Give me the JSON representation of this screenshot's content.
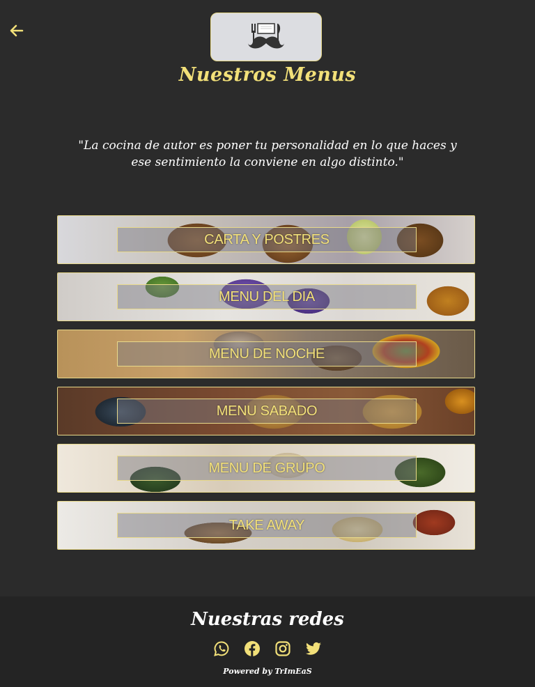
{
  "header": {
    "title": "Nuestros Menus",
    "logo_icon": "chef-mustache-logo-icon",
    "back_icon": "arrow-left-icon"
  },
  "quote": "\"La cocina de autor es poner tu personalidad en lo que haces y ese sentimiento la conviene en algo distinto.\"",
  "menus": [
    {
      "label": "CARTA Y POSTRES"
    },
    {
      "label": "MENU DEL DIA"
    },
    {
      "label": "MENU DE NOCHE"
    },
    {
      "label": "MENU SABADO"
    },
    {
      "label": "MENU DE GRUPO"
    },
    {
      "label": "TAKE AWAY"
    }
  ],
  "footer": {
    "title": "Nuestras redes",
    "social": [
      "whatsapp-icon",
      "facebook-icon",
      "instagram-icon",
      "twitter-icon"
    ],
    "powered_by": "Powered by TrImEaS"
  },
  "colors": {
    "background": "#2b2b2b",
    "accent": "#f2e079",
    "footer_bg": "#242424"
  }
}
